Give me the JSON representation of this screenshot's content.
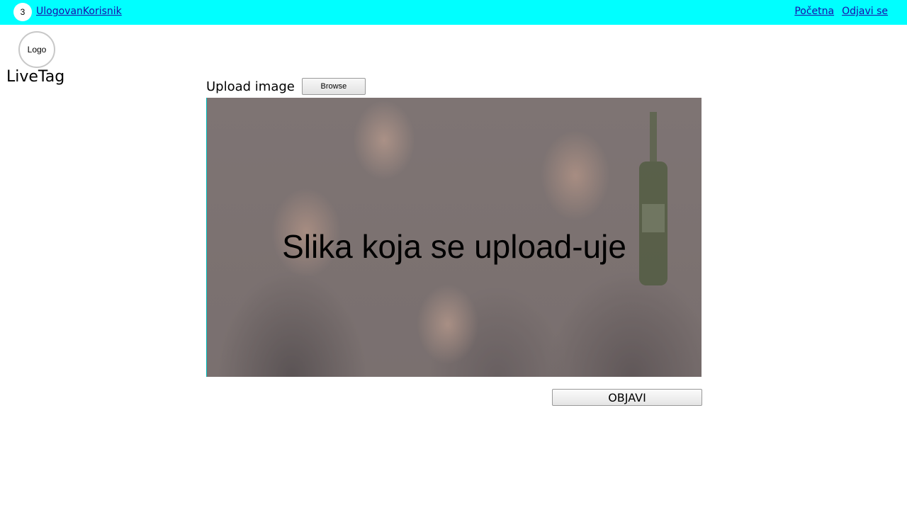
{
  "header": {
    "badge_count": "3",
    "username": "UlogovanKorisnik",
    "nav": {
      "home": "Početna",
      "logout": "Odjavi se"
    },
    "background_color": "#00ffff"
  },
  "brand": {
    "logo_text": "Logo",
    "name": "LiveTag"
  },
  "upload": {
    "label": "Upload image",
    "browse_label": "Browse"
  },
  "preview": {
    "caption": "Slika koja se upload-uje"
  },
  "actions": {
    "publish_label": "OBJAVI"
  }
}
